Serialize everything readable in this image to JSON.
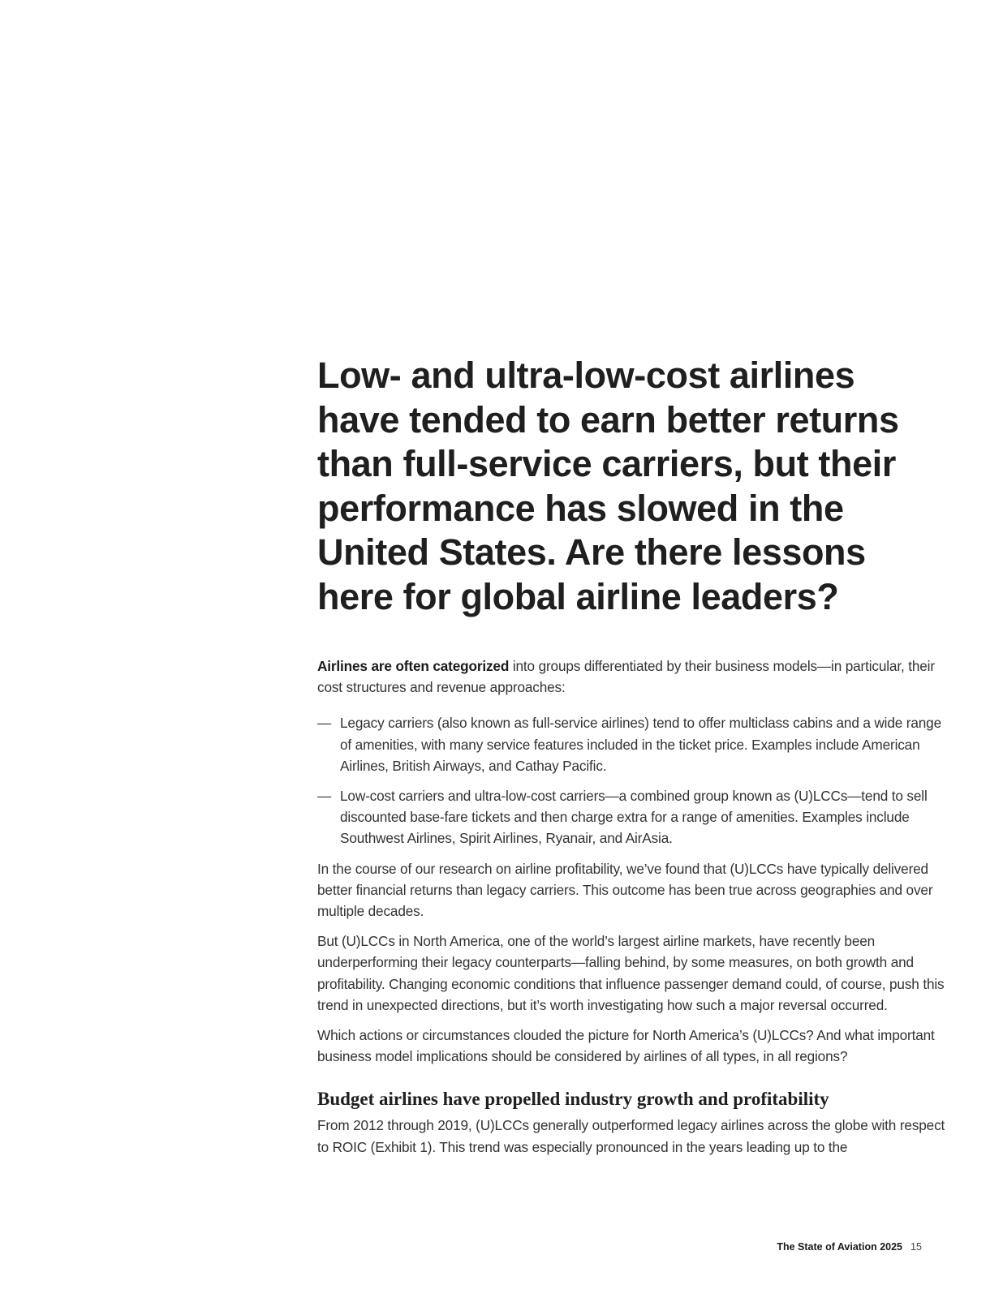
{
  "headline": "Low- and ultra-low-cost airlines have tended to earn better returns than full-service carriers, but their performance has slowed in the United States. Are there lessons here for global airline leaders?",
  "intro": {
    "lead": "Airlines are often categorized",
    "rest": " into groups differentiated by their business models—in particular, their cost structures and revenue approaches:"
  },
  "bullets": [
    {
      "dash": "—",
      "text": "Legacy carriers (also known as full-service airlines) tend to offer multiclass cabins and a wide range of amenities, with many service features included in the ticket price. Examples include American Airlines, British Airways, and Cathay Pacific."
    },
    {
      "dash": "—",
      "text": "Low-cost carriers and ultra-low-cost carriers—a combined group known as (U)LCCs—tend to sell discounted base-fare tickets and then charge extra for a range of amenities. Examples include Southwest Airlines, Spirit Airlines, Ryanair, and AirAsia."
    }
  ],
  "paragraphs": [
    "In the course of our research on airline profitability, we’ve found that (U)LCCs have typically delivered better financial returns than legacy carriers. This outcome has been true across geographies and over multiple decades.",
    "But (U)LCCs in North America, one of the world’s largest airline markets, have recently been underperforming their legacy counterparts—falling behind, by some measures, on both growth and profitability. Changing economic conditions that influence passenger demand could, of course, push this trend in unexpected directions, but it’s worth investigating how such a major reversal occurred.",
    "Which actions or circumstances clouded the picture for North America’s (U)LCCs? And what important business model implications should be considered by airlines of all types, in all regions?"
  ],
  "subhead": "Budget airlines have propelled industry growth and profitability",
  "subhead_paragraph": "From 2012 through 2019, (U)LCCs generally outperformed legacy airlines across the globe with respect to ROIC (Exhibit 1). This trend was especially pronounced in the years leading up to the",
  "footer": {
    "publication": "The State of Aviation 2025",
    "page_number": "15"
  }
}
